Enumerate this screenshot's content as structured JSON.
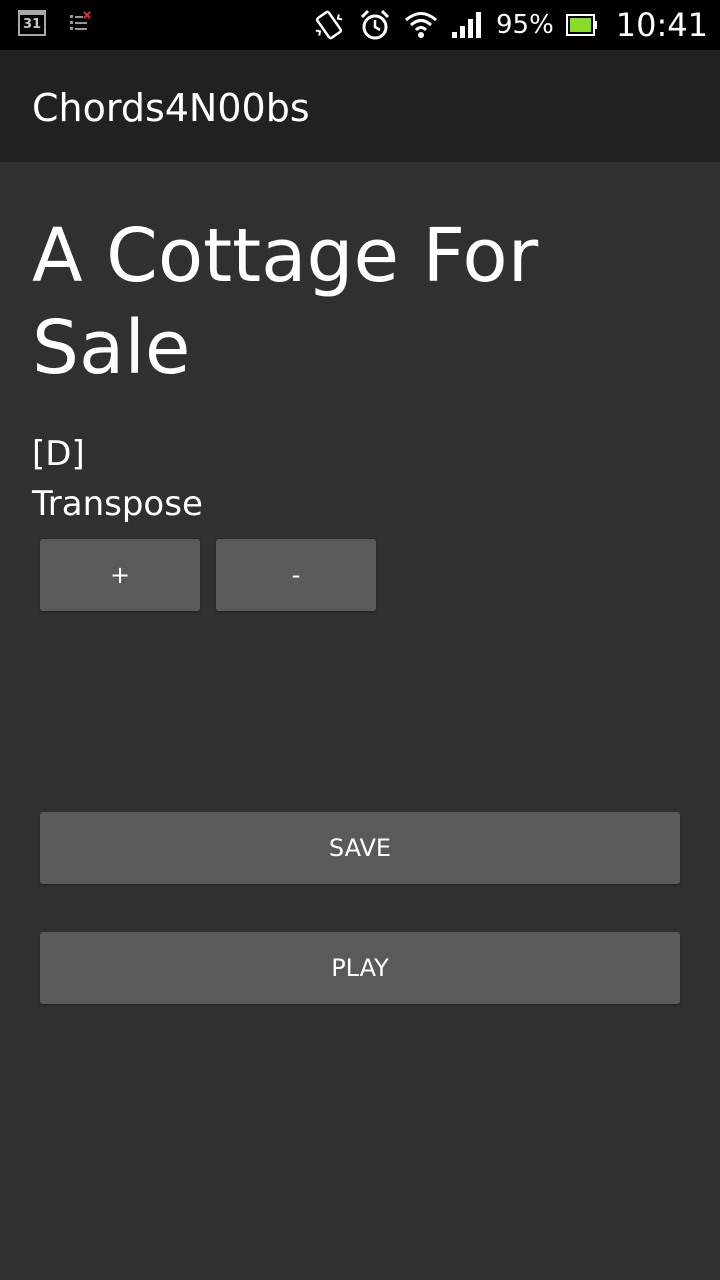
{
  "status_bar": {
    "calendar_day": "31",
    "battery_percent": "95%",
    "time": "10:41",
    "icons": [
      "calendar-icon",
      "task-list-icon",
      "vibrate-icon",
      "alarm-icon",
      "wifi-icon",
      "signal-icon",
      "battery-icon"
    ]
  },
  "action_bar": {
    "title": "Chords4N00bs"
  },
  "song": {
    "title": "A Cottage For Sale",
    "key": "[D]",
    "transpose_label": "Transpose"
  },
  "buttons": {
    "plus": "+",
    "minus": "-",
    "save": "SAVE",
    "play": "PLAY"
  },
  "colors": {
    "background": "#303030",
    "action_bar": "#212121",
    "button": "#5a5a5b",
    "battery_fill": "#8bdc28"
  }
}
